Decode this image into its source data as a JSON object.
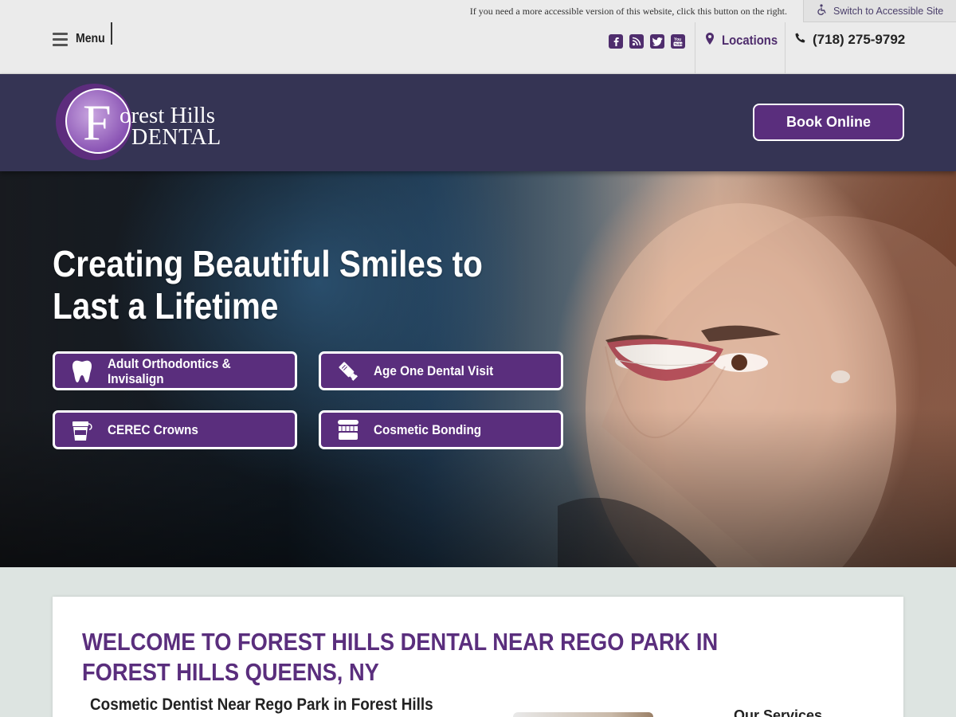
{
  "accessibility": {
    "notice": "If you need a more accessible version of this website, click this button on the right.",
    "button_label": "Switch to Accessible Site",
    "button_icon": "wheelchair-icon"
  },
  "utility": {
    "menu_label": "Menu",
    "social": [
      {
        "name": "facebook-icon",
        "glyph": "f"
      },
      {
        "name": "rss-icon",
        "glyph": ""
      },
      {
        "name": "twitter-icon",
        "glyph": ""
      },
      {
        "name": "youtube-icon",
        "glyph": ""
      }
    ],
    "locations_label": "Locations",
    "phone": "(718) 275-9792"
  },
  "header": {
    "logo_line1": "orest Hills",
    "logo_initial": "F",
    "logo_line2": "DENTAL",
    "book_label": "Book Online"
  },
  "hero": {
    "title": "Creating Beautiful Smiles to Last a Lifetime",
    "buttons": [
      {
        "label": "Adult Orthodontics & Invisalign",
        "icon": "tooth-icon"
      },
      {
        "label": "Age One Dental Visit",
        "icon": "toothpaste-icon"
      },
      {
        "label": "CEREC Crowns",
        "icon": "floss-icon"
      },
      {
        "label": "Cosmetic Bonding",
        "icon": "toothbrush-icon"
      }
    ]
  },
  "main": {
    "welcome_title": "WELCOME TO FOREST HILLS DENTAL NEAR REGO PARK IN FOREST HILLS QUEENS, NY",
    "subheading": "Cosmetic Dentist Near Rego Park in Forest Hills",
    "services_title": "Our Services"
  },
  "colors": {
    "brand_purple": "#5a2e7d",
    "header_navy": "#353454",
    "title_purple": "#5a2e7d"
  }
}
